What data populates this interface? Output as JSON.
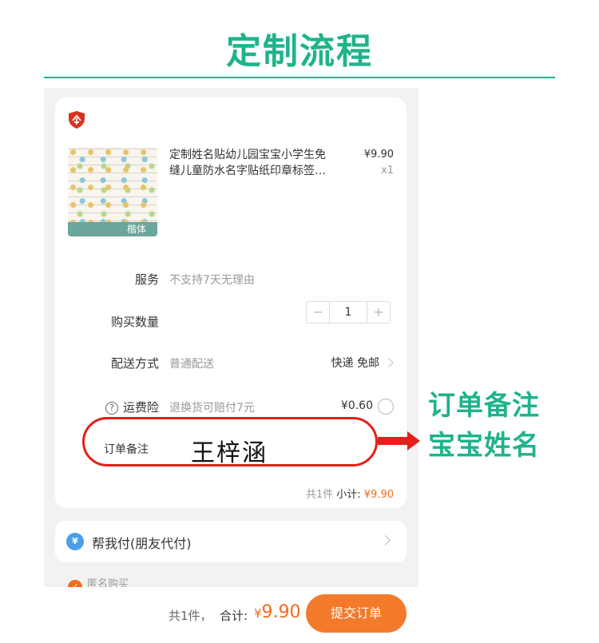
{
  "page_title": "定制流程",
  "order": {
    "product": {
      "title_line1": "定制姓名贴幼儿园宝宝小学生免",
      "title_line2": "缝儿童防水名字贴纸印章标签…",
      "thumb_label": "楷体",
      "price": "¥9.90",
      "qty": "x1"
    },
    "service": {
      "label": "服务",
      "value": "不支持7天无理由"
    },
    "quantity": {
      "label": "购买数量",
      "minus": "−",
      "value": "1",
      "plus": "+"
    },
    "delivery": {
      "label": "配送方式",
      "value": "普通配送",
      "right": "快递 免邮"
    },
    "insurance": {
      "label": "运费险",
      "value": "退换货可赔付7元",
      "price": "¥0.60",
      "help_glyph": "?"
    },
    "note": {
      "label": "订单备注",
      "value": "王梓涵"
    },
    "subtotal": {
      "count": "共1件",
      "label": "小计:",
      "amount": "¥9.90"
    }
  },
  "friend_pay": {
    "label": "帮我付(朋友代付)",
    "icon_glyph": "¥"
  },
  "anonymous": {
    "label": "匿名购买",
    "check_glyph": "✓"
  },
  "annotation": {
    "line1": "订单备注",
    "line2": "宝宝姓名"
  },
  "bottom_bar": {
    "count": "共1件，",
    "total_label": "合计:",
    "currency": "¥",
    "total_amount": "9.90",
    "submit_label": "提交订单"
  },
  "colors": {
    "accent": "#1fb38c",
    "price": "#f56a1e",
    "highlight": "#e3201a",
    "submit": "#f27a2a"
  },
  "icons": [
    "shop-shield-icon",
    "help-circle-icon",
    "chevron-right-icon",
    "radio-icon",
    "friend-pay-icon",
    "check-icon",
    "arrow-right-icon"
  ]
}
